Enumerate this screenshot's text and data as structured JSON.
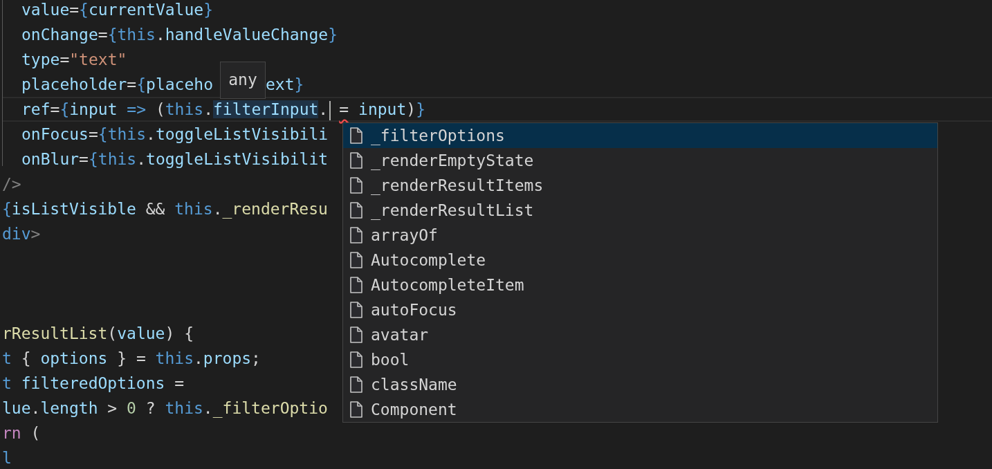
{
  "code_lines": [
    {
      "indent": true,
      "current": false,
      "tokens": [
        {
          "text": "value",
          "kind": "attr"
        },
        {
          "text": "=",
          "kind": "punct"
        },
        {
          "text": "{",
          "kind": "brace"
        },
        {
          "text": "currentValue",
          "kind": "var"
        },
        {
          "text": "}",
          "kind": "brace"
        }
      ]
    },
    {
      "indent": true,
      "current": false,
      "tokens": [
        {
          "text": "onChange",
          "kind": "attr"
        },
        {
          "text": "=",
          "kind": "punct"
        },
        {
          "text": "{",
          "kind": "brace"
        },
        {
          "text": "this",
          "kind": "keyword"
        },
        {
          "text": ".",
          "kind": "punct"
        },
        {
          "text": "handleValueChange",
          "kind": "var"
        },
        {
          "text": "}",
          "kind": "brace"
        }
      ]
    },
    {
      "indent": true,
      "current": false,
      "tokens": [
        {
          "text": "type",
          "kind": "attr"
        },
        {
          "text": "=",
          "kind": "punct"
        },
        {
          "text": "\"text\"",
          "kind": "string"
        }
      ]
    },
    {
      "indent": true,
      "current": false,
      "tokens": [
        {
          "text": "placeholder",
          "kind": "attr"
        },
        {
          "text": "=",
          "kind": "punct"
        },
        {
          "text": "{",
          "kind": "brace"
        },
        {
          "text": "placeho",
          "kind": "var"
        },
        {
          "text": "any",
          "kind": "tooltip"
        },
        {
          "text": "ext",
          "kind": "var"
        },
        {
          "text": "}",
          "kind": "brace"
        }
      ]
    },
    {
      "indent": true,
      "current": true,
      "tokens": [
        {
          "text": "ref",
          "kind": "attr"
        },
        {
          "text": "=",
          "kind": "punct"
        },
        {
          "text": "{",
          "kind": "brace"
        },
        {
          "text": "input ",
          "kind": "var"
        },
        {
          "text": "=>",
          "kind": "keyword"
        },
        {
          "text": " (",
          "kind": "punct"
        },
        {
          "text": "this",
          "kind": "keyword"
        },
        {
          "text": ".",
          "kind": "punct"
        },
        {
          "text": "filterInput",
          "kind": "match"
        },
        {
          "text": ".",
          "kind": "punct"
        },
        {
          "kind": "cursor"
        },
        {
          "text": "=",
          "kind": "punct",
          "error": true
        },
        {
          "text": "input",
          "kind": "var"
        },
        {
          "text": ")",
          "kind": "punct"
        },
        {
          "text": "}",
          "kind": "brace"
        }
      ]
    },
    {
      "indent": true,
      "current": false,
      "tokens": [
        {
          "text": "onFocus",
          "kind": "attr"
        },
        {
          "text": "=",
          "kind": "punct"
        },
        {
          "text": "{",
          "kind": "brace"
        },
        {
          "text": "this",
          "kind": "keyword"
        },
        {
          "text": ".",
          "kind": "punct"
        },
        {
          "text": "toggleListVisibili",
          "kind": "var"
        }
      ]
    },
    {
      "indent": true,
      "current": false,
      "tokens": [
        {
          "text": "onBlur",
          "kind": "attr"
        },
        {
          "text": "=",
          "kind": "punct"
        },
        {
          "text": "{",
          "kind": "brace"
        },
        {
          "text": "this",
          "kind": "keyword"
        },
        {
          "text": ".",
          "kind": "punct"
        },
        {
          "text": "toggleListVisibilit",
          "kind": "var"
        }
      ]
    },
    {
      "indent": false,
      "current": false,
      "tokens": [
        {
          "text": "/>",
          "kind": "tagpunct"
        }
      ]
    },
    {
      "indent": false,
      "current": false,
      "tokens": [
        {
          "text": "{",
          "kind": "brace"
        },
        {
          "text": "isListVisible",
          "kind": "var"
        },
        {
          "text": " && ",
          "kind": "punct"
        },
        {
          "text": "this",
          "kind": "keyword"
        },
        {
          "text": ".",
          "kind": "punct"
        },
        {
          "text": "_renderResu",
          "kind": "func"
        }
      ]
    },
    {
      "indent": false,
      "current": false,
      "tokens": [
        {
          "text": "div",
          "kind": "keyword"
        },
        {
          "text": ">",
          "kind": "tagpunct"
        }
      ]
    },
    {
      "current": false
    },
    {
      "current": false
    },
    {
      "current": false
    },
    {
      "indent": false,
      "current": false,
      "tokens": [
        {
          "text": "rResultList",
          "kind": "func"
        },
        {
          "text": "(",
          "kind": "punct"
        },
        {
          "text": "value",
          "kind": "var"
        },
        {
          "text": ") {",
          "kind": "punct"
        }
      ]
    },
    {
      "indent": false,
      "current": false,
      "tokens": [
        {
          "text": "t",
          "kind": "keyword"
        },
        {
          "text": " { ",
          "kind": "punct"
        },
        {
          "text": "options",
          "kind": "var"
        },
        {
          "text": " } = ",
          "kind": "punct"
        },
        {
          "text": "this",
          "kind": "keyword"
        },
        {
          "text": ".",
          "kind": "punct"
        },
        {
          "text": "props",
          "kind": "var"
        },
        {
          "text": ";",
          "kind": "punct"
        }
      ]
    },
    {
      "indent": false,
      "current": false,
      "tokens": [
        {
          "text": "t",
          "kind": "keyword"
        },
        {
          "text": " filteredOptions",
          "kind": "var"
        },
        {
          "text": " =",
          "kind": "punct"
        }
      ]
    },
    {
      "indent": false,
      "current": false,
      "tokens": [
        {
          "text": "lue",
          "kind": "var"
        },
        {
          "text": ".",
          "kind": "punct"
        },
        {
          "text": "length",
          "kind": "var"
        },
        {
          "text": " > ",
          "kind": "punct"
        },
        {
          "text": "0",
          "kind": "number"
        },
        {
          "text": " ? ",
          "kind": "punct"
        },
        {
          "text": "this",
          "kind": "keyword"
        },
        {
          "text": ".",
          "kind": "punct"
        },
        {
          "text": "_filterOptio",
          "kind": "func"
        }
      ]
    },
    {
      "indent": false,
      "current": false,
      "tokens": [
        {
          "text": "rn",
          "kind": "control"
        },
        {
          "text": " (",
          "kind": "punct"
        }
      ]
    },
    {
      "indent": false,
      "current": false,
      "tokens": [
        {
          "text": "l",
          "kind": "keyword"
        }
      ]
    }
  ],
  "suggestions": [
    {
      "label": "_filterOptions",
      "selected": true
    },
    {
      "label": "_renderEmptyState",
      "selected": false
    },
    {
      "label": "_renderResultItems",
      "selected": false
    },
    {
      "label": "_renderResultList",
      "selected": false
    },
    {
      "label": "arrayOf",
      "selected": false
    },
    {
      "label": "Autocomplete",
      "selected": false
    },
    {
      "label": "AutocompleteItem",
      "selected": false
    },
    {
      "label": "autoFocus",
      "selected": false
    },
    {
      "label": "avatar",
      "selected": false
    },
    {
      "label": "bool",
      "selected": false
    },
    {
      "label": "className",
      "selected": false
    },
    {
      "label": "Component",
      "selected": false
    }
  ]
}
